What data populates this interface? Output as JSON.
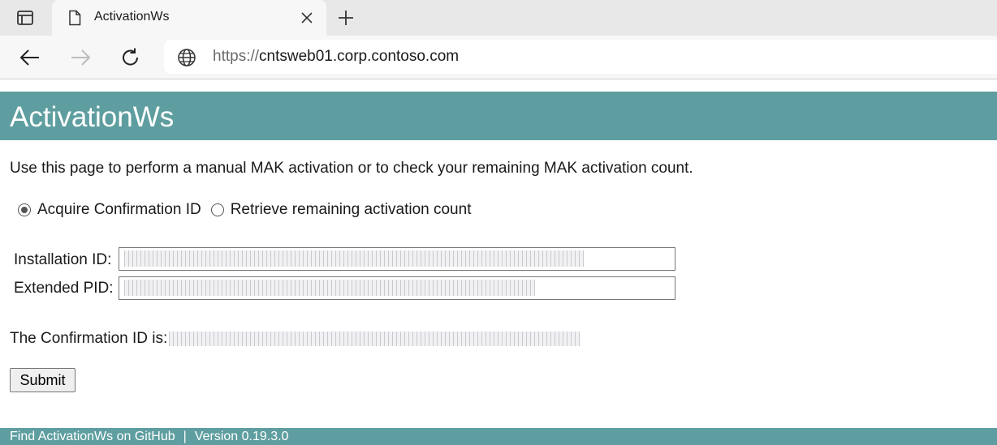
{
  "browser": {
    "tab_title": "ActivationWs",
    "url_scheme": "https://",
    "url_host": "cntsweb01.corp.contoso.com"
  },
  "page": {
    "title": "ActivationWs",
    "intro": "Use this page to perform a manual MAK activation or to check your remaining MAK activation count.",
    "radio_options": [
      {
        "label": "Acquire Confirmation ID",
        "checked": true
      },
      {
        "label": "Retrieve remaining activation count",
        "checked": false
      }
    ],
    "installation_id_label": "Installation ID:",
    "extended_pid_label": "Extended PID:",
    "confirmation_label": "The Confirmation ID is:",
    "submit_label": "Submit"
  },
  "footer": {
    "github_link": "Find ActivationWs on GitHub",
    "separator": "|",
    "version": "Version 0.19.3.0"
  },
  "colors": {
    "brand": "#5f9ea0",
    "chrome_bg": "#e8e8e8",
    "toolbar_bg": "#f7f7f7"
  },
  "icons": [
    "tab-actions-icon",
    "page-icon",
    "close-icon",
    "plus-icon",
    "back-arrow-icon",
    "forward-arrow-icon",
    "refresh-icon",
    "globe-icon",
    "radio-checked-icon",
    "radio-unchecked-icon"
  ]
}
